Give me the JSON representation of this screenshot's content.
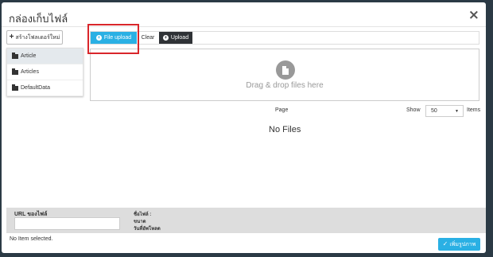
{
  "dialog": {
    "title": "กล่องเก็บไฟล์",
    "close_label": "×"
  },
  "sidebar": {
    "new_folder_label": "สร้างโฟลเดอร์ใหม่",
    "new_folder_icon": "plus-icon",
    "folders": [
      {
        "label": "Article",
        "active": true
      },
      {
        "label": "Articles",
        "active": false
      },
      {
        "label": "DefaultData",
        "active": false
      }
    ]
  },
  "toolbar": {
    "file_upload_label": "File upload",
    "clear_label": "Clear",
    "upload_label": "Upload",
    "file_upload_icon": "plus-circle-icon",
    "upload_icon": "plus-circle-icon"
  },
  "dropzone": {
    "text": "Drag & drop files here",
    "icon": "file-icon"
  },
  "pager": {
    "page_label": "Page",
    "show_label": "Show",
    "page_size": "50",
    "items_label": "Items"
  },
  "empty_state": "No Files",
  "info": {
    "url_label": "URL ของไฟล์",
    "url_value": "",
    "filename_label": "ชื่อไฟล์ :",
    "size_label": "ขนาด",
    "upload_date_label": "วันที่อัพโหลด"
  },
  "footer": {
    "status": "No Item selected.",
    "confirm_label": "เพิ่มรูปภาพ"
  },
  "colors": {
    "accent": "#2ab0e4",
    "upload_button": "#2f3236",
    "highlight_box": "#d9262b",
    "info_bar": "#dddddd"
  }
}
